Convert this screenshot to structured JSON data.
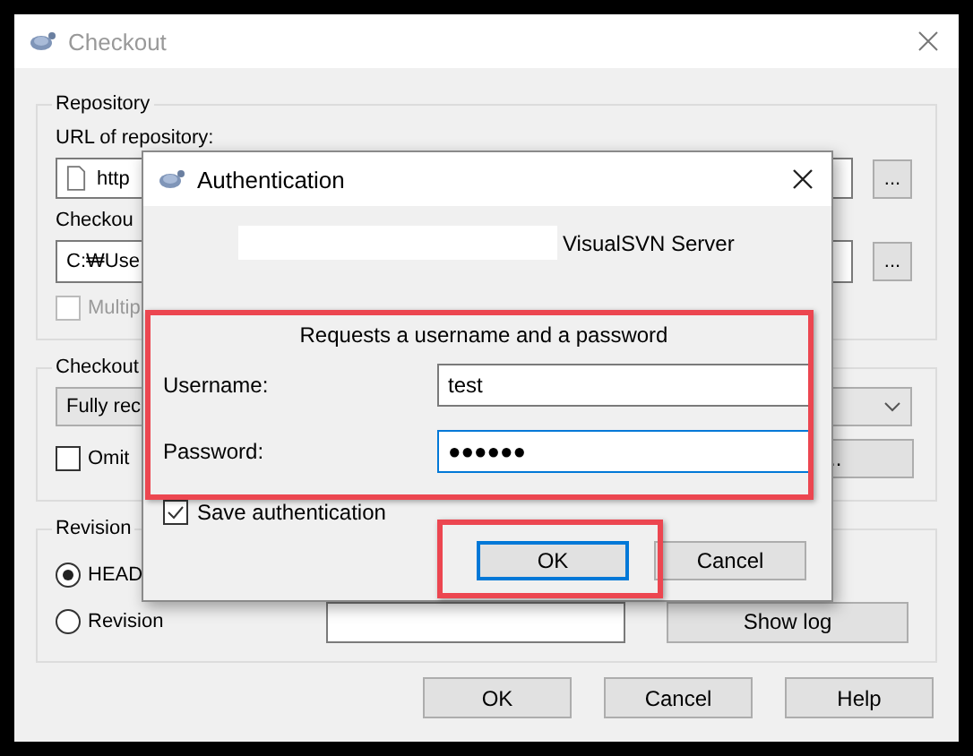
{
  "main_window": {
    "title": "Checkout"
  },
  "repository": {
    "legend": "Repository",
    "url_label": "URL of repository:",
    "url_value": "http",
    "dir_label": "Checkou",
    "dir_value": "C:₩Use",
    "browse_buttons": [
      "...",
      "..."
    ],
    "multiple": {
      "label": "Multip",
      "checked": false,
      "disabled": true
    }
  },
  "depth": {
    "legend": "Checkout",
    "value": "Fully rec",
    "omit": {
      "label": "Omit",
      "checked": false,
      "disabled": false
    },
    "items_button": ".."
  },
  "revision": {
    "legend": "Revision",
    "options": [
      {
        "label": "HEAD",
        "selected": true
      },
      {
        "label": "Revision",
        "selected": false
      }
    ],
    "show_log": "Show log"
  },
  "buttons": [
    "OK",
    "Cancel",
    "Help"
  ],
  "auth_dialog": {
    "title": "Authentication",
    "realm": "VisualSVN Server",
    "prompt": "Requests a username and a password",
    "fields": [
      {
        "label": "Username:",
        "value": "test",
        "focused": false
      },
      {
        "label": "Password:",
        "value": "●●●●●●",
        "focused": true
      }
    ],
    "save": {
      "label": "Save authentication",
      "checked": true
    },
    "buttons": [
      {
        "label": "OK",
        "default": true
      },
      {
        "label": "Cancel",
        "default": false
      }
    ]
  }
}
